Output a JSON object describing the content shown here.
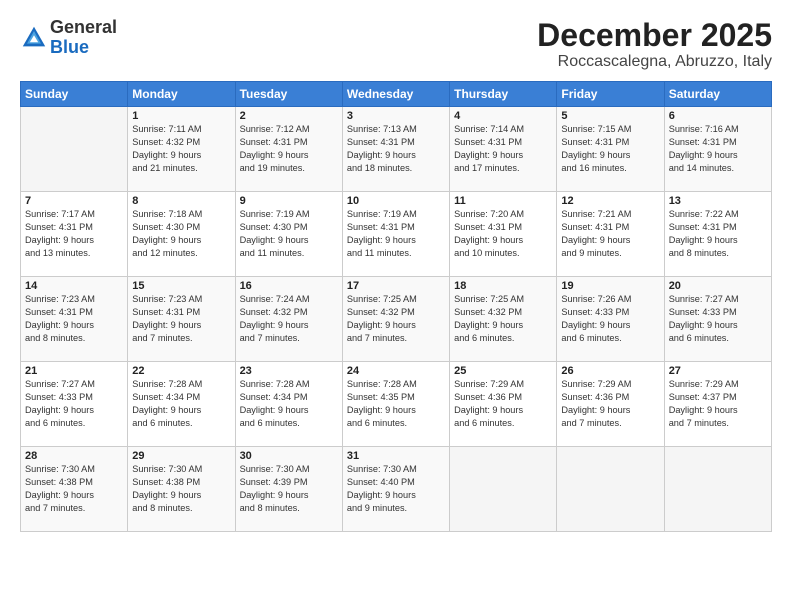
{
  "logo": {
    "general": "General",
    "blue": "Blue"
  },
  "title": "December 2025",
  "location": "Roccascalegna, Abruzzo, Italy",
  "days_header": [
    "Sunday",
    "Monday",
    "Tuesday",
    "Wednesday",
    "Thursday",
    "Friday",
    "Saturday"
  ],
  "weeks": [
    [
      {
        "day": "",
        "info": ""
      },
      {
        "day": "1",
        "info": "Sunrise: 7:11 AM\nSunset: 4:32 PM\nDaylight: 9 hours\nand 21 minutes."
      },
      {
        "day": "2",
        "info": "Sunrise: 7:12 AM\nSunset: 4:31 PM\nDaylight: 9 hours\nand 19 minutes."
      },
      {
        "day": "3",
        "info": "Sunrise: 7:13 AM\nSunset: 4:31 PM\nDaylight: 9 hours\nand 18 minutes."
      },
      {
        "day": "4",
        "info": "Sunrise: 7:14 AM\nSunset: 4:31 PM\nDaylight: 9 hours\nand 17 minutes."
      },
      {
        "day": "5",
        "info": "Sunrise: 7:15 AM\nSunset: 4:31 PM\nDaylight: 9 hours\nand 16 minutes."
      },
      {
        "day": "6",
        "info": "Sunrise: 7:16 AM\nSunset: 4:31 PM\nDaylight: 9 hours\nand 14 minutes."
      }
    ],
    [
      {
        "day": "7",
        "info": "Sunrise: 7:17 AM\nSunset: 4:31 PM\nDaylight: 9 hours\nand 13 minutes."
      },
      {
        "day": "8",
        "info": "Sunrise: 7:18 AM\nSunset: 4:30 PM\nDaylight: 9 hours\nand 12 minutes."
      },
      {
        "day": "9",
        "info": "Sunrise: 7:19 AM\nSunset: 4:30 PM\nDaylight: 9 hours\nand 11 minutes."
      },
      {
        "day": "10",
        "info": "Sunrise: 7:19 AM\nSunset: 4:31 PM\nDaylight: 9 hours\nand 11 minutes."
      },
      {
        "day": "11",
        "info": "Sunrise: 7:20 AM\nSunset: 4:31 PM\nDaylight: 9 hours\nand 10 minutes."
      },
      {
        "day": "12",
        "info": "Sunrise: 7:21 AM\nSunset: 4:31 PM\nDaylight: 9 hours\nand 9 minutes."
      },
      {
        "day": "13",
        "info": "Sunrise: 7:22 AM\nSunset: 4:31 PM\nDaylight: 9 hours\nand 8 minutes."
      }
    ],
    [
      {
        "day": "14",
        "info": "Sunrise: 7:23 AM\nSunset: 4:31 PM\nDaylight: 9 hours\nand 8 minutes."
      },
      {
        "day": "15",
        "info": "Sunrise: 7:23 AM\nSunset: 4:31 PM\nDaylight: 9 hours\nand 7 minutes."
      },
      {
        "day": "16",
        "info": "Sunrise: 7:24 AM\nSunset: 4:32 PM\nDaylight: 9 hours\nand 7 minutes."
      },
      {
        "day": "17",
        "info": "Sunrise: 7:25 AM\nSunset: 4:32 PM\nDaylight: 9 hours\nand 7 minutes."
      },
      {
        "day": "18",
        "info": "Sunrise: 7:25 AM\nSunset: 4:32 PM\nDaylight: 9 hours\nand 6 minutes."
      },
      {
        "day": "19",
        "info": "Sunrise: 7:26 AM\nSunset: 4:33 PM\nDaylight: 9 hours\nand 6 minutes."
      },
      {
        "day": "20",
        "info": "Sunrise: 7:27 AM\nSunset: 4:33 PM\nDaylight: 9 hours\nand 6 minutes."
      }
    ],
    [
      {
        "day": "21",
        "info": "Sunrise: 7:27 AM\nSunset: 4:33 PM\nDaylight: 9 hours\nand 6 minutes."
      },
      {
        "day": "22",
        "info": "Sunrise: 7:28 AM\nSunset: 4:34 PM\nDaylight: 9 hours\nand 6 minutes."
      },
      {
        "day": "23",
        "info": "Sunrise: 7:28 AM\nSunset: 4:34 PM\nDaylight: 9 hours\nand 6 minutes."
      },
      {
        "day": "24",
        "info": "Sunrise: 7:28 AM\nSunset: 4:35 PM\nDaylight: 9 hours\nand 6 minutes."
      },
      {
        "day": "25",
        "info": "Sunrise: 7:29 AM\nSunset: 4:36 PM\nDaylight: 9 hours\nand 6 minutes."
      },
      {
        "day": "26",
        "info": "Sunrise: 7:29 AM\nSunset: 4:36 PM\nDaylight: 9 hours\nand 7 minutes."
      },
      {
        "day": "27",
        "info": "Sunrise: 7:29 AM\nSunset: 4:37 PM\nDaylight: 9 hours\nand 7 minutes."
      }
    ],
    [
      {
        "day": "28",
        "info": "Sunrise: 7:30 AM\nSunset: 4:38 PM\nDaylight: 9 hours\nand 7 minutes."
      },
      {
        "day": "29",
        "info": "Sunrise: 7:30 AM\nSunset: 4:38 PM\nDaylight: 9 hours\nand 8 minutes."
      },
      {
        "day": "30",
        "info": "Sunrise: 7:30 AM\nSunset: 4:39 PM\nDaylight: 9 hours\nand 8 minutes."
      },
      {
        "day": "31",
        "info": "Sunrise: 7:30 AM\nSunset: 4:40 PM\nDaylight: 9 hours\nand 9 minutes."
      },
      {
        "day": "",
        "info": ""
      },
      {
        "day": "",
        "info": ""
      },
      {
        "day": "",
        "info": ""
      }
    ]
  ]
}
